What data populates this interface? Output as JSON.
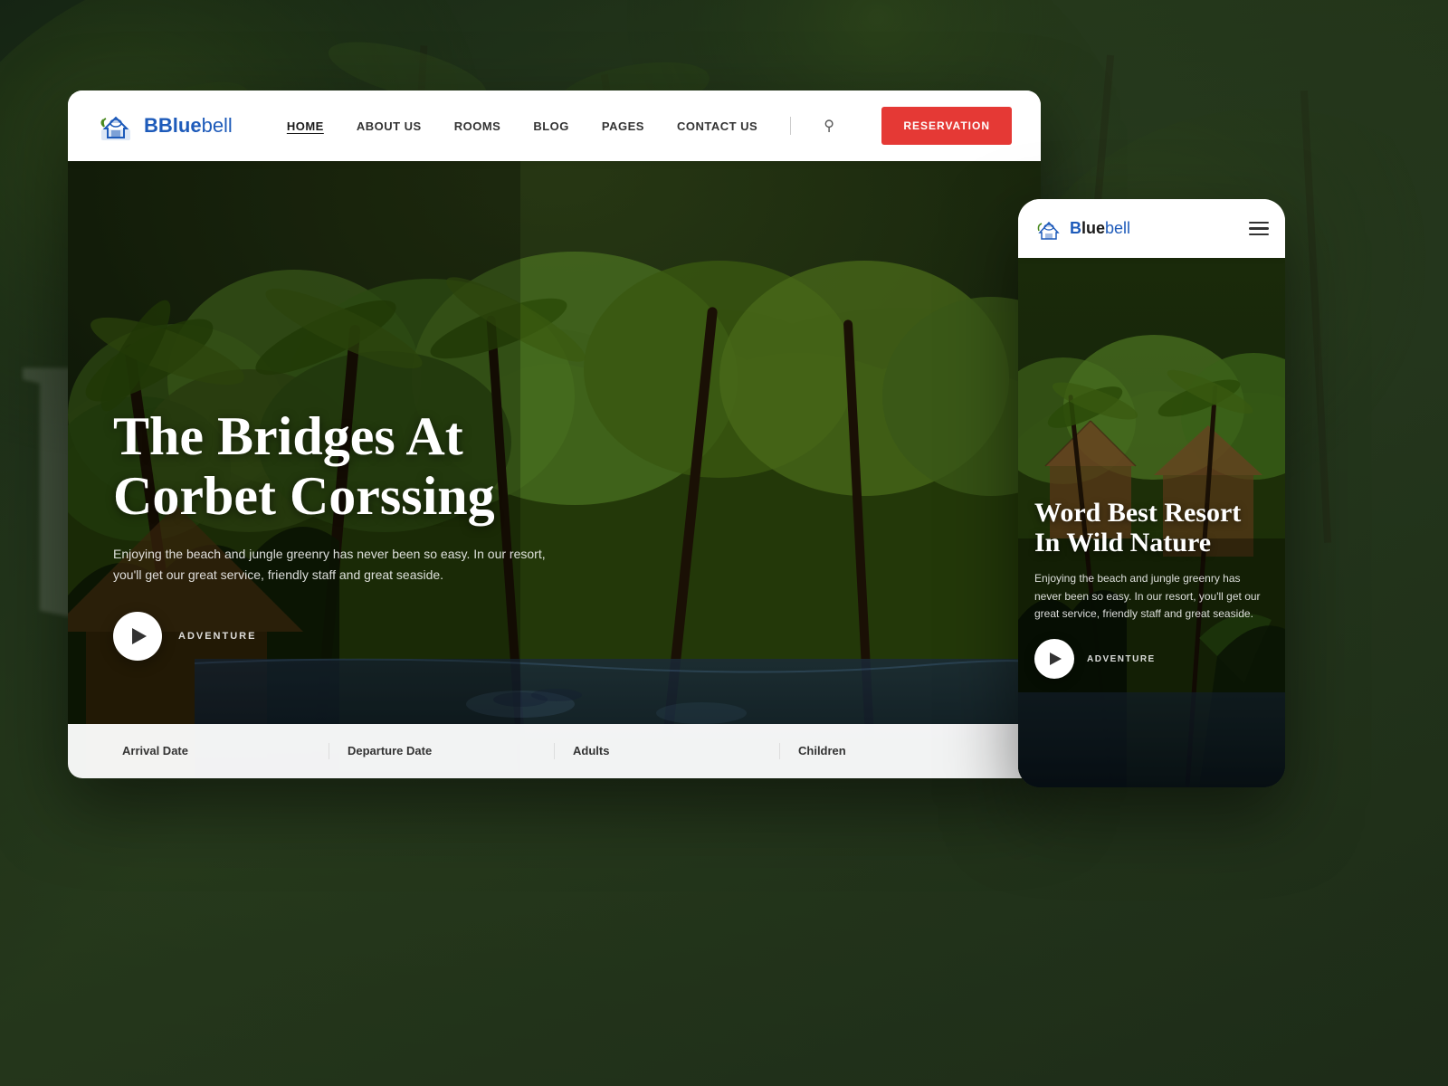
{
  "site": {
    "name_prefix": "Blue",
    "name_suffix": "bell"
  },
  "desktop": {
    "nav": {
      "links": [
        {
          "id": "home",
          "label": "HOME",
          "active": true
        },
        {
          "id": "about",
          "label": "ABOUT US",
          "active": false
        },
        {
          "id": "rooms",
          "label": "ROOMS",
          "active": false
        },
        {
          "id": "blog",
          "label": "BLOG",
          "active": false
        },
        {
          "id": "pages",
          "label": "PAGES",
          "active": false
        },
        {
          "id": "contact",
          "label": "CONTACT US",
          "active": false
        }
      ],
      "reservation_btn": "RESERVATION"
    },
    "hero": {
      "title": "The Bridges At Corbet Corssing",
      "subtitle": "Enjoying the beach and jungle greenry has never been so easy. In our resort, you'll get our great service, friendly staff and great seaside.",
      "play_label": "ADVENTURE"
    },
    "booking": {
      "fields": [
        {
          "id": "arrival",
          "label": "Arrival Date"
        },
        {
          "id": "departure",
          "label": "Departure Date"
        },
        {
          "id": "adults",
          "label": "Adults"
        },
        {
          "id": "children",
          "label": "Children"
        }
      ]
    }
  },
  "mobile": {
    "hero": {
      "title": "Word Best Resort In Wild Nature",
      "subtitle": "Enjoying the beach and jungle greenry has never been so easy. In our resort, you'll get our great service, friendly staff and great seaside.",
      "play_label": "ADVENTURE"
    }
  },
  "colors": {
    "brand_blue": "#1e5bba",
    "reservation_red": "#e53935",
    "nav_text": "#333333",
    "hero_title": "#ffffff",
    "hero_subtitle": "rgba(255,255,255,0.85)"
  }
}
